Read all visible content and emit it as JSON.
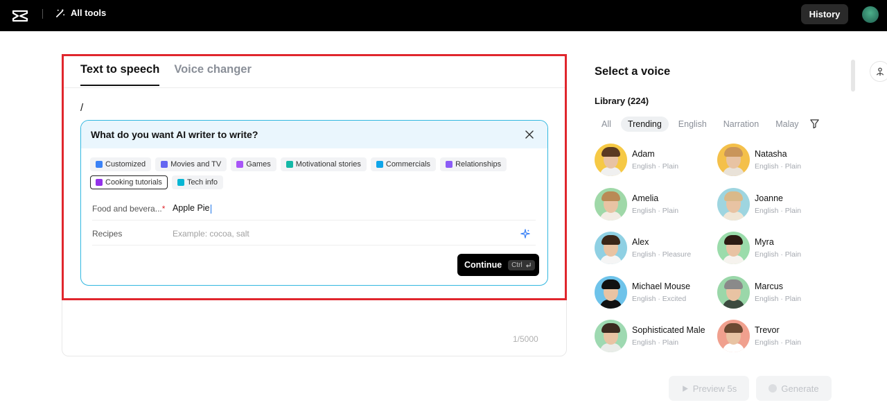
{
  "topbar": {
    "all_tools_label": "All tools",
    "history_label": "History"
  },
  "editor": {
    "tabs": [
      {
        "label": "Text to speech",
        "active": true
      },
      {
        "label": "Voice changer",
        "active": false
      }
    ],
    "text_content": "/",
    "char_count": "1/5000"
  },
  "ai_writer": {
    "title": "What do you want AI writer to write?",
    "chips": [
      {
        "label": "Customized",
        "color": "#3b82f6",
        "selected": false
      },
      {
        "label": "Movies and TV",
        "color": "#6366f1",
        "selected": false
      },
      {
        "label": "Games",
        "color": "#a855f7",
        "selected": false
      },
      {
        "label": "Motivational stories",
        "color": "#14b8a6",
        "selected": false
      },
      {
        "label": "Commercials",
        "color": "#0ea5e9",
        "selected": false
      },
      {
        "label": "Relationships",
        "color": "#8b5cf6",
        "selected": false
      },
      {
        "label": "Cooking tutorials",
        "color": "#9333ea",
        "selected": true
      },
      {
        "label": "Tech info",
        "color": "#06b6d4",
        "selected": false
      }
    ],
    "fields": {
      "food_label": "Food and bevera...",
      "food_value": "Apple Pie",
      "recipes_label": "Recipes",
      "recipes_placeholder": "Example: cocoa, salt"
    },
    "continue_label": "Continue",
    "shortcut_label": "Ctrl"
  },
  "voice_panel": {
    "title": "Select a voice",
    "library_label": "Library (224)",
    "filters": [
      {
        "label": "All",
        "active": false
      },
      {
        "label": "Trending",
        "active": true
      },
      {
        "label": "English",
        "active": false
      },
      {
        "label": "Narration",
        "active": false
      },
      {
        "label": "Malay",
        "active": false
      }
    ],
    "voices": [
      {
        "name": "Adam",
        "desc": "English · Plain",
        "bg": "#f6c945",
        "hair": "#5a3a22",
        "shirt": "#f0f0f0"
      },
      {
        "name": "Natasha",
        "desc": "English · Plain",
        "bg": "#f4c04a",
        "hair": "#c9955a",
        "shirt": "#e9e2d8"
      },
      {
        "name": "Amelia",
        "desc": "English · Plain",
        "bg": "#9fd8a8",
        "hair": "#b98a55",
        "shirt": "#f2ece4"
      },
      {
        "name": "Joanne",
        "desc": "English · Plain",
        "bg": "#9ed5e0",
        "hair": "#d9b98a",
        "shirt": "#f0e6d6"
      },
      {
        "name": "Alex",
        "desc": "English · Pleasure",
        "bg": "#8fd0e3",
        "hair": "#3a2618",
        "shirt": "#f5f5f5"
      },
      {
        "name": "Myra",
        "desc": "English · Plain",
        "bg": "#9bdcab",
        "hair": "#2c1b12",
        "shirt": "#f6f3ee"
      },
      {
        "name": "Michael Mouse",
        "desc": "English · Excited",
        "bg": "#6ec3ea",
        "hair": "#111111",
        "shirt": "#111111"
      },
      {
        "name": "Marcus",
        "desc": "English · Plain",
        "bg": "#9ad7a9",
        "hair": "#8a8a8a",
        "shirt": "#3c4a3f"
      },
      {
        "name": "Sophisticated Male",
        "desc": "English · Plain",
        "bg": "#9ed9b1",
        "hair": "#3b2a20",
        "shirt": "#e9ece8"
      },
      {
        "name": "Trevor",
        "desc": "English · Plain",
        "bg": "#f0a08e",
        "hair": "#6b4a32",
        "shirt": "#ffffff"
      }
    ],
    "preview_label": "Preview 5s",
    "generate_label": "Generate"
  }
}
